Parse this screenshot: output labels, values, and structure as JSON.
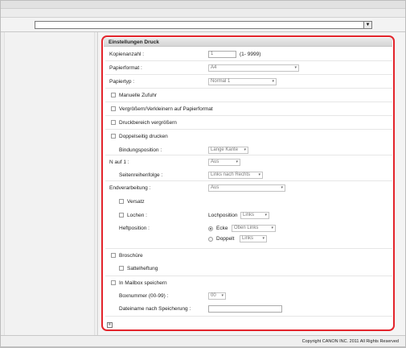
{
  "nav": {
    "select_value": "",
    "arrow_glyph": "▼"
  },
  "panel": {
    "title": "Einstellungen Druck",
    "kopienanzahl": {
      "label": "Kopienanzahl :",
      "value": "1",
      "range": "(1- 9999)"
    },
    "papierformat": {
      "label": "Papierformat :",
      "value": "A4"
    },
    "papiertyp": {
      "label": "Papiertyp :",
      "value": "Normal 1"
    },
    "manuelle_zufuhr": {
      "label": "Manuelle Zufuhr"
    },
    "vergroessern": {
      "label": "Vergrößern/Verkleinern auf Papierformat"
    },
    "druckbereich": {
      "label": "Druckbereich vergrößern"
    },
    "doppelseitig": {
      "label": "Doppelseitig drucken"
    },
    "bindungsposition": {
      "label": "Bindungsposition :",
      "value": "Lange Kante"
    },
    "n_auf_1": {
      "label": "N auf 1 :",
      "value": "Aus"
    },
    "seitenreihenfolge": {
      "label": "Seitenreihenfolge :",
      "value": "Links nach Rechts"
    },
    "endverarbeitung": {
      "label": "Endverarbeitung :",
      "value": "Aus"
    },
    "versatz": {
      "label": "Versatz"
    },
    "lochen": {
      "label": "Lochen :"
    },
    "lochposition": {
      "label": "Lochposition",
      "value": "Links"
    },
    "heftposition": {
      "label": "Heftposition :"
    },
    "ecke": {
      "label": "Ecke",
      "value": "Oben Links"
    },
    "doppelt": {
      "label": "Doppelt",
      "value": "Links"
    },
    "broschuere": {
      "label": "Broschüre"
    },
    "sattelheftung": {
      "label": "Sattelheftung"
    },
    "mailbox": {
      "label": "In Mailbox speichern"
    },
    "boxnummer": {
      "label": "Boxnummer (00-99) :",
      "value": "00"
    },
    "dateiname": {
      "label": "Dateiname nach Speicherung :",
      "value": ""
    },
    "footer_icon_glyph": "≡"
  },
  "caret_glyph": "▾",
  "copyright": "Copyright CANON INC. 2011 All Rights Reserved"
}
